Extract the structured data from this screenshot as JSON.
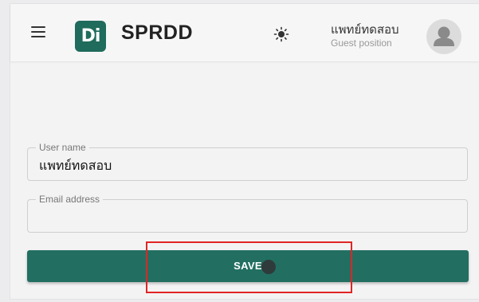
{
  "header": {
    "menu_icon": "hamburger-menu-icon",
    "logo_text": "Di",
    "app_name": "SPRDD",
    "theme_icon": "sun-icon",
    "user": {
      "name": "แพทย์ทดสอบ",
      "role": "Guest position",
      "avatar_icon": "person-icon"
    }
  },
  "form": {
    "username": {
      "label": "User name",
      "value": "แพทย์ทดสอบ"
    },
    "email": {
      "label": "Email address",
      "value": ""
    },
    "save_label": "SAVE"
  },
  "colors": {
    "accent": "#226f62",
    "logo_bg": "#1f6b5c",
    "highlight": "#e02424"
  }
}
